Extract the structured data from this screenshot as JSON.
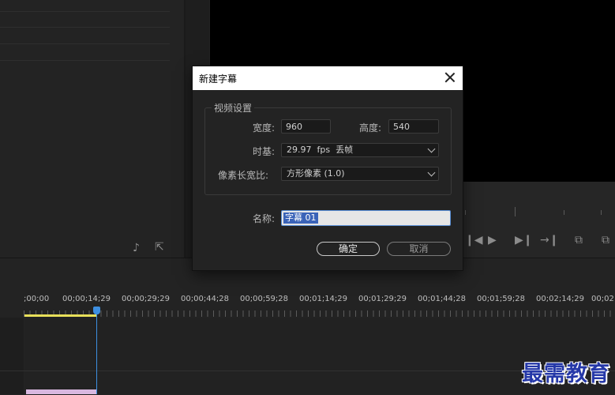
{
  "dialog": {
    "title": "新建字幕",
    "video_settings_legend": "视频设置",
    "width_label": "宽度:",
    "width_value": "960",
    "height_label": "高度:",
    "height_value": "540",
    "timebase_label": "时基:",
    "timebase_value": "29.97  fps  丢帧",
    "pixel_aspect_label": "像素长宽比:",
    "pixel_aspect_value": "方形像素 (1.0)",
    "name_label": "名称:",
    "name_value": "字幕 01",
    "ok_label": "确定",
    "cancel_label": "取消"
  },
  "timeline": {
    "ruler_labels": [
      ";00;00",
      "00;00;14;29",
      "00;00;29;29",
      "00;00;44;28",
      "00;00;59;28",
      "00;01;14;29",
      "00;01;29;29",
      "00;01;44;28",
      "00;01;59;28",
      "00;02;14;29",
      "00;02"
    ],
    "colors": {
      "playhead": "#3d8fe0",
      "work_area": "#e8e05a",
      "clip": "#d9b8e0"
    }
  },
  "watermark": "最需教育"
}
